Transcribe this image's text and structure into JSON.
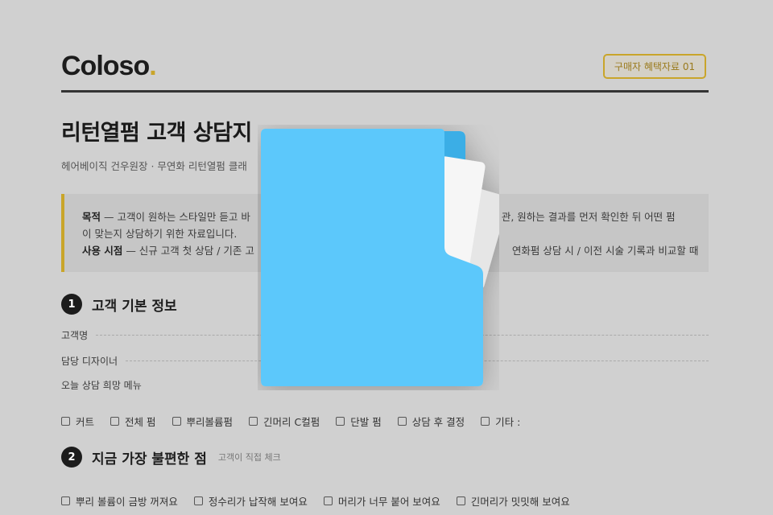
{
  "header": {
    "logo_text": "Coloso",
    "logo_dot": ".",
    "badge": "구매자 혜택자료 01"
  },
  "document": {
    "title": "리턴열펌 고객 상담지",
    "subtitle": "헤어베이직 건우원장 · 무연화 리턴열펌 클래"
  },
  "notice": {
    "purpose_label": "목적",
    "purpose_left": " — 고객이 원하는 스타일만 듣고 바",
    "purpose_right": "관, 원하는 결과를 먼저 확인한 뒤 어떤 펌",
    "purpose_line2": "이 맞는지 상담하기 위한 자료입니다.",
    "usage_label": "사용 시점",
    "usage_left": " — 신규 고객 첫 상담 / 기존 고",
    "usage_right": "연화펌 상담 시 / 이전 시술 기록과 비교할 때"
  },
  "section1": {
    "number": "1",
    "title": "고객 기본 정보",
    "fields": [
      "고객명",
      "담당 디자이너",
      "오늘 상담 희망 메뉴"
    ],
    "options": [
      "커트",
      "전체 펌",
      "뿌리볼륨펌",
      "긴머리 C컬펌",
      "단발 펌",
      "상담 후 결정",
      "기타 :"
    ]
  },
  "section2": {
    "number": "2",
    "title": "지금 가장 불편한 점",
    "note": "고객이 직접 체크",
    "options": [
      "뿌리 볼륨이 금방 꺼져요",
      "정수리가 납작해 보여요",
      "머리가 너무 붙어 보여요",
      "긴머리가 밋밋해 보여요"
    ]
  },
  "overlay": {
    "icon": "folder-icon",
    "colors": {
      "folder": "#5bc8fb",
      "folder_back": "#3aaee6",
      "paper": "#f4f4f4"
    }
  }
}
